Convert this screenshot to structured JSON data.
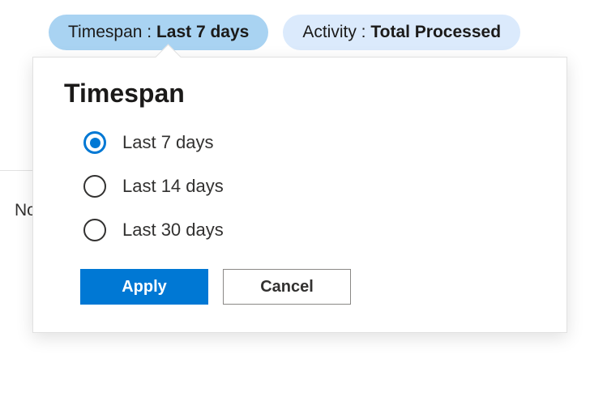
{
  "pills": {
    "timespan": {
      "key": "Timespan : ",
      "value": "Last 7 days"
    },
    "activity": {
      "key": "Activity : ",
      "value": "Total Processed"
    }
  },
  "background_text": "No",
  "popover": {
    "title": "Timespan",
    "options": [
      {
        "label": "Last 7 days",
        "selected": true
      },
      {
        "label": "Last 14 days",
        "selected": false
      },
      {
        "label": "Last 30 days",
        "selected": false
      }
    ],
    "apply_label": "Apply",
    "cancel_label": "Cancel"
  }
}
